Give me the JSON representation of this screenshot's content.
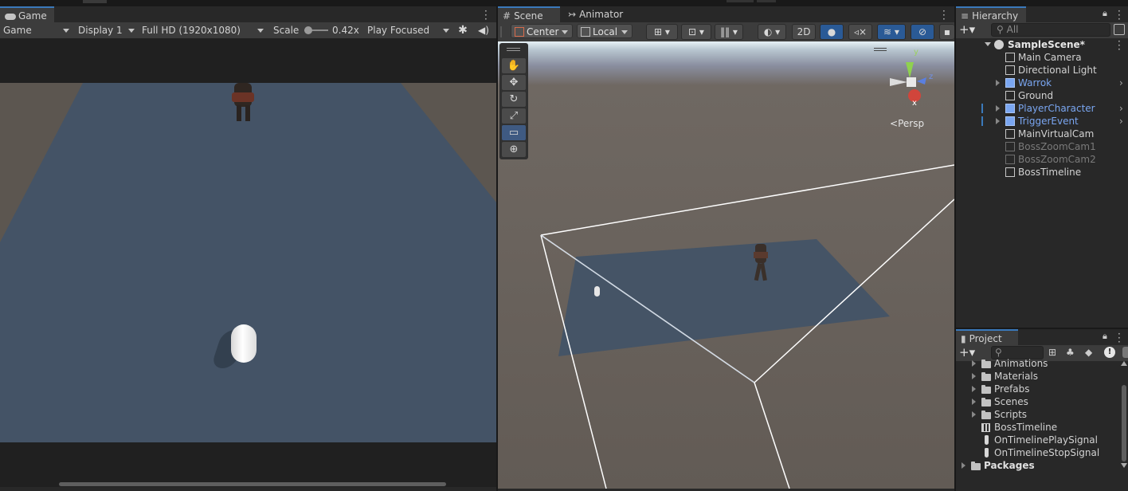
{
  "colors": {
    "accent": "#3a79bb",
    "prefab_blue": "#7aa6f1",
    "inactive": "#7a7a7a"
  },
  "game": {
    "tab_label": "Game",
    "mode": "Game",
    "display": "Display 1",
    "resolution": "Full HD (1920x1080)",
    "scale_label": "Scale",
    "scale_value": "0.42x",
    "scale_fraction": 0.0,
    "play_mode": "Play Focused",
    "icons": [
      "game-controller-icon",
      "bug-icon",
      "speaker-icon",
      "kebab-menu-icon"
    ]
  },
  "scene": {
    "tab_label": "Scene",
    "animator_tab_label": "Animator",
    "pivot": "Center",
    "space": "Local",
    "mode_2d": "2D",
    "persp_label": "Persp",
    "gizmo_axes": {
      "y": "y",
      "z": "z",
      "x": "x"
    },
    "tools": [
      "hand-icon",
      "move-icon",
      "rotate-icon",
      "scale-icon",
      "rect-icon",
      "transform-icon"
    ]
  },
  "hierarchy": {
    "tab_label": "Hierarchy",
    "search_placeholder": "All",
    "scene_name": "SampleScene*",
    "items": [
      {
        "label": "Main Camera",
        "type": "normal",
        "expandable": false
      },
      {
        "label": "Directional Light",
        "type": "normal",
        "expandable": false
      },
      {
        "label": "Warrok",
        "type": "prefab",
        "expandable": true
      },
      {
        "label": "Ground",
        "type": "normal",
        "expandable": false
      },
      {
        "label": "PlayerCharacter",
        "type": "prefab",
        "expandable": true
      },
      {
        "label": "TriggerEvent",
        "type": "prefab",
        "expandable": true
      },
      {
        "label": "MainVirtualCam",
        "type": "normal",
        "expandable": false
      },
      {
        "label": "BossZoomCam1",
        "type": "inactive",
        "expandable": false
      },
      {
        "label": "BossZoomCam2",
        "type": "inactive",
        "expandable": false
      },
      {
        "label": "BossTimeline",
        "type": "normal",
        "expandable": false
      }
    ]
  },
  "project": {
    "tab_label": "Project",
    "search_placeholder": "",
    "folders": [
      "Animations",
      "Materials",
      "Prefabs",
      "Scenes",
      "Scripts"
    ],
    "assets": [
      {
        "label": "BossTimeline",
        "icon": "timeline-icon"
      },
      {
        "label": "OnTimelinePlaySignal",
        "icon": "signal-icon"
      },
      {
        "label": "OnTimelineStopSignal",
        "icon": "signal-icon"
      }
    ],
    "packages_label": "Packages"
  }
}
